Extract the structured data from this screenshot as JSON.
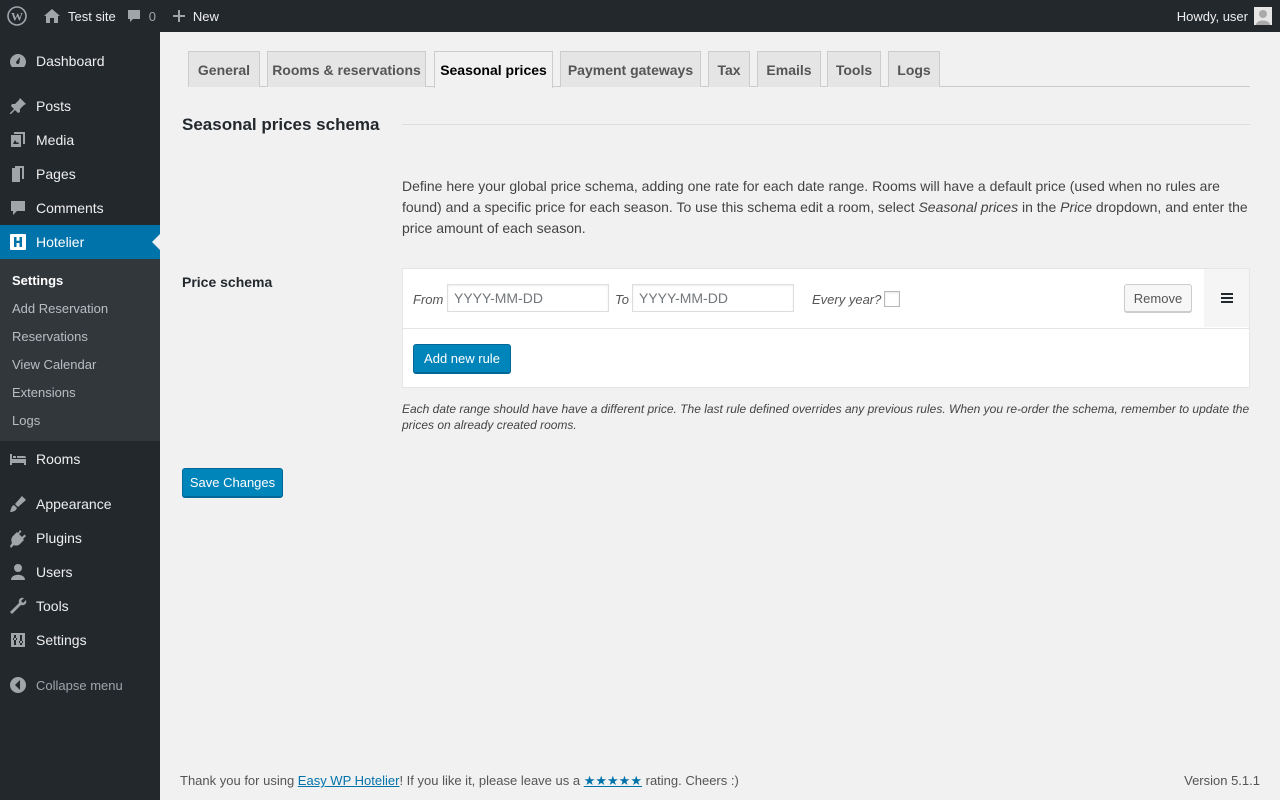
{
  "adminbar": {
    "site_name": "Test site",
    "comments_count": "0",
    "new_label": "New",
    "greeting": "Howdy, user"
  },
  "sidebar": {
    "items": [
      {
        "label": "Dashboard",
        "icon": "dashboard-icon"
      },
      {
        "label": "Posts",
        "icon": "pin-icon"
      },
      {
        "label": "Media",
        "icon": "media-icon"
      },
      {
        "label": "Pages",
        "icon": "pages-icon"
      },
      {
        "label": "Comments",
        "icon": "comment-icon"
      },
      {
        "label": "Hotelier",
        "icon": "hotelier-icon",
        "active": true
      },
      {
        "label": "Rooms",
        "icon": "bed-icon"
      },
      {
        "label": "Appearance",
        "icon": "brush-icon"
      },
      {
        "label": "Plugins",
        "icon": "plug-icon"
      },
      {
        "label": "Users",
        "icon": "user-icon"
      },
      {
        "label": "Tools",
        "icon": "wrench-icon"
      },
      {
        "label": "Settings",
        "icon": "settings-icon"
      }
    ],
    "submenu": [
      "Settings",
      "Add Reservation",
      "Reservations",
      "View Calendar",
      "Extensions",
      "Logs"
    ],
    "collapse_label": "Collapse menu"
  },
  "tabs": [
    "General",
    "Rooms & reservations",
    "Seasonal prices",
    "Payment gateways",
    "Tax",
    "Emails",
    "Tools",
    "Logs"
  ],
  "active_tab": "Seasonal prices",
  "section": {
    "title": "Seasonal prices schema",
    "desc_1": "Define here your global price schema, adding one rate for each date range. Rooms will have a default price (used when no rules are found) and a specific price for each season. To use this schema edit a room, select ",
    "desc_em1": "Seasonal prices",
    "desc_2": " in the ",
    "desc_em2": "Price",
    "desc_3": " dropdown, and enter the price amount of each season."
  },
  "schema": {
    "label": "Price schema",
    "from_label": "From",
    "from_placeholder": "YYYY-MM-DD",
    "to_label": "To",
    "to_placeholder": "YYYY-MM-DD",
    "every_year_label": "Every year?",
    "remove_label": "Remove",
    "add_rule_label": "Add new rule",
    "help": "Each date range should have have a different price. The last rule defined overrides any previous rules. When you re-order the schema, remember to update the prices on already created rooms."
  },
  "save_label": "Save Changes",
  "footer": {
    "text_1": "Thank you for using ",
    "link_text": "Easy WP Hotelier",
    "text_2": "! If you like it, please leave us a ",
    "stars": "★★★★★",
    "text_3": " rating. Cheers :)",
    "version": "Version 5.1.1"
  },
  "colors": {
    "accent": "#0073aa",
    "primary_button": "#0085ba",
    "sidebar_bg": "#23282d"
  }
}
